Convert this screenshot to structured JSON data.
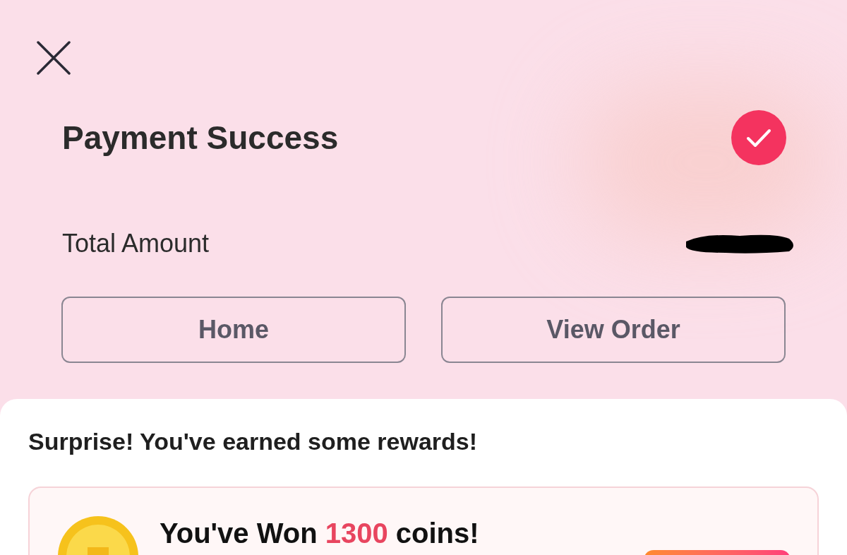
{
  "header": {
    "title": "Payment Success",
    "success": true
  },
  "total": {
    "label": "Total Amount",
    "redacted": true
  },
  "buttons": [
    "Home",
    "View Order"
  ],
  "rewards": {
    "heading": "Surprise! You've earned some rewards!",
    "coin_reward": {
      "prefix": "You've Won",
      "amount": "1300",
      "suffix": "coins!"
    }
  }
}
